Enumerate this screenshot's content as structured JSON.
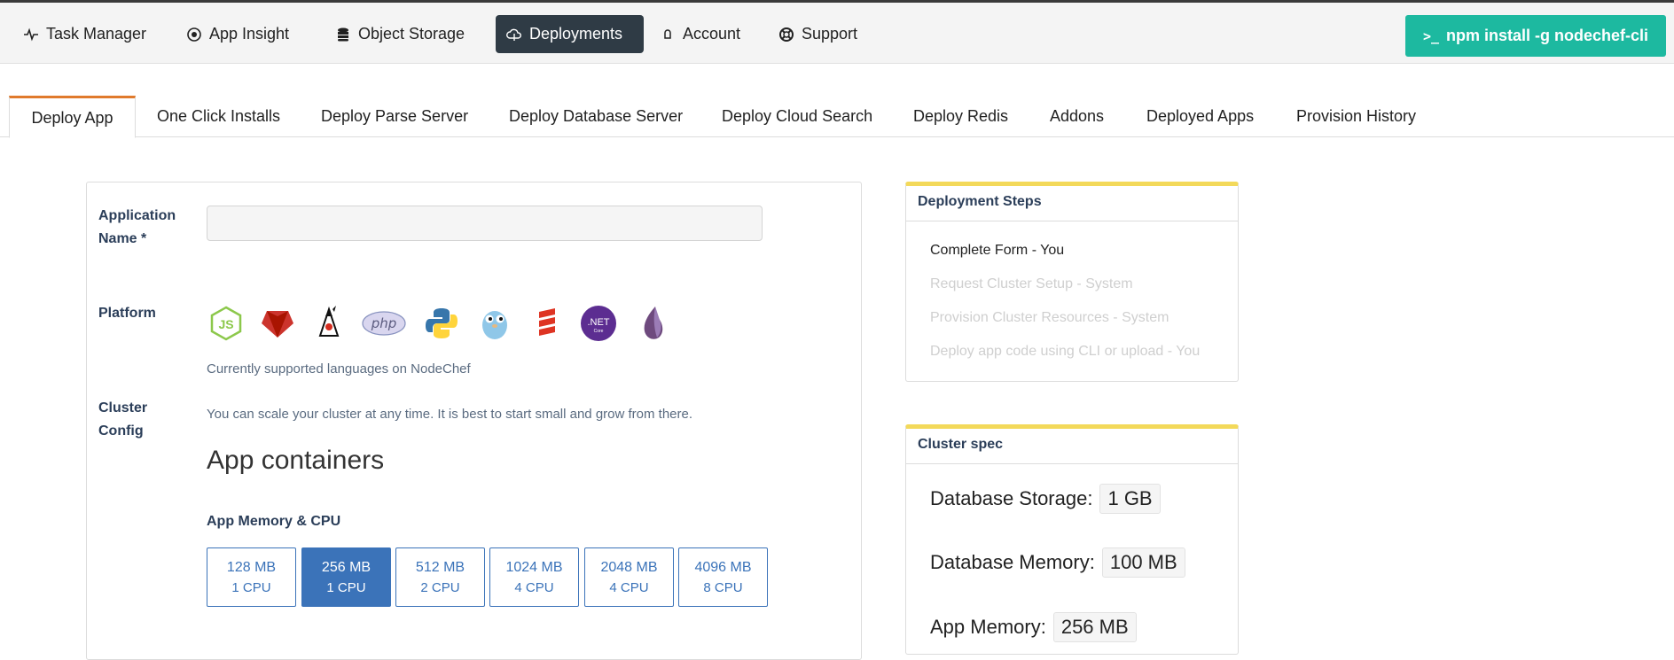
{
  "nav": {
    "items": [
      {
        "label": "Task Manager",
        "icon": "activity-icon"
      },
      {
        "label": "App Insight",
        "icon": "target-icon"
      },
      {
        "label": "Object Storage",
        "icon": "database-icon"
      },
      {
        "label": "Deployments",
        "icon": "cloud-upload-icon",
        "active": true
      },
      {
        "label": "Account",
        "icon": "user-icon"
      },
      {
        "label": "Support",
        "icon": "lifebuoy-icon"
      }
    ],
    "cta_label": "npm install -g nodechef-cli",
    "cta_prompt": ">_"
  },
  "tabs": [
    {
      "label": "Deploy App",
      "active": true
    },
    {
      "label": "One Click Installs"
    },
    {
      "label": "Deploy Parse Server"
    },
    {
      "label": "Deploy Database Server"
    },
    {
      "label": "Deploy Cloud Search"
    },
    {
      "label": "Deploy Redis"
    },
    {
      "label": "Addons"
    },
    {
      "label": "Deployed Apps"
    },
    {
      "label": "Provision History"
    }
  ],
  "form": {
    "app_name_label_line1": "Application",
    "app_name_label_line2": "Name *",
    "app_name_value": "",
    "platform_label": "Platform",
    "platforms": [
      "nodejs-icon",
      "ruby-icon",
      "java-icon",
      "php-icon",
      "python-icon",
      "go-icon",
      "scala-icon",
      "dotnet-core-icon",
      "elixir-icon"
    ],
    "php_text": "php",
    "net_text": ".NET",
    "net_sub": "Core",
    "platform_help": "Currently supported languages on NodeChef",
    "cluster_label_line1": "Cluster",
    "cluster_label_line2": "Config",
    "cluster_help": "You can scale your cluster at any time. It is best to start small and grow from there.",
    "containers_title": "App containers",
    "memory_title": "App Memory & CPU",
    "memory_options": [
      {
        "mem": "128 MB",
        "cpu": "1 CPU"
      },
      {
        "mem": "256 MB",
        "cpu": "1 CPU",
        "selected": true
      },
      {
        "mem": "512 MB",
        "cpu": "2 CPU"
      },
      {
        "mem": "1024 MB",
        "cpu": "4 CPU"
      },
      {
        "mem": "2048 MB",
        "cpu": "4 CPU"
      },
      {
        "mem": "4096 MB",
        "cpu": "8 CPU"
      }
    ]
  },
  "steps_panel": {
    "title": "Deployment Steps",
    "steps": [
      {
        "label": "Complete Form - You",
        "state": "done"
      },
      {
        "label": "Request Cluster Setup - System",
        "state": "todo"
      },
      {
        "label": "Provision Cluster Resources - System",
        "state": "todo"
      },
      {
        "label": "Deploy app code using CLI or upload - You",
        "state": "todo"
      }
    ]
  },
  "spec_panel": {
    "title": "Cluster spec",
    "rows": [
      {
        "label": "Database Storage:",
        "value": "1 GB"
      },
      {
        "label": "Database Memory:",
        "value": "100 MB"
      },
      {
        "label": "App Memory:",
        "value": "256 MB"
      }
    ]
  },
  "colors": {
    "accent_teal": "#1db9a0",
    "selected_blue": "#3b73b9",
    "tab_accent": "#e07a2c",
    "panel_accent": "#f3d95a",
    "nav_active": "#2f3b45"
  }
}
